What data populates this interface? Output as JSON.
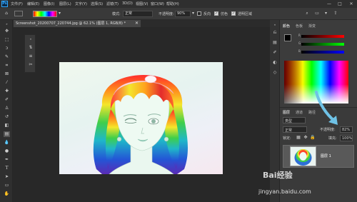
{
  "menubar": {
    "logo": "Ps",
    "items": [
      "文件(F)",
      "编辑(E)",
      "图像(I)",
      "图层(L)",
      "文字(Y)",
      "选择(S)",
      "滤镜(T)",
      "3D(D)",
      "视图(V)",
      "窗口(W)",
      "帮助(H)"
    ],
    "minimize": "—",
    "maximize": "□",
    "close": "✕"
  },
  "options": {
    "mode_label": "模式:",
    "mode_value": "正常",
    "opacity_label": "不透明度:",
    "opacity_value": "90%",
    "reverse_label": "反向",
    "dither_label": "仿色",
    "transparency_label": "透明区域"
  },
  "document": {
    "tab_title": "Screenshot_20200707_220744.jpg @ 62.1% (图层 1, RGB/8) *",
    "close": "✕"
  },
  "panels": {
    "color_tab": "颜色",
    "swatches_tab": "色板",
    "gradient_tab": "渐变",
    "layers_tab": "图层",
    "channels_tab": "通道",
    "paths_tab": "路径"
  },
  "layers": {
    "kind_label": "类型",
    "blend_mode": "正常",
    "opacity_label": "不透明度:",
    "opacity_value": "82%",
    "lock_label": "锁定:",
    "fill_label": "填充:",
    "fill_value": "100%",
    "layer_name": "图层 1",
    "fx_hint": "fx"
  },
  "watermark": {
    "text": "jingyan.baidu.com",
    "brand": "Bai经验"
  },
  "colors": {
    "accent": "#31a8ff",
    "arrow": "#6fc2e6",
    "panel_bg": "#3c3c3c"
  }
}
